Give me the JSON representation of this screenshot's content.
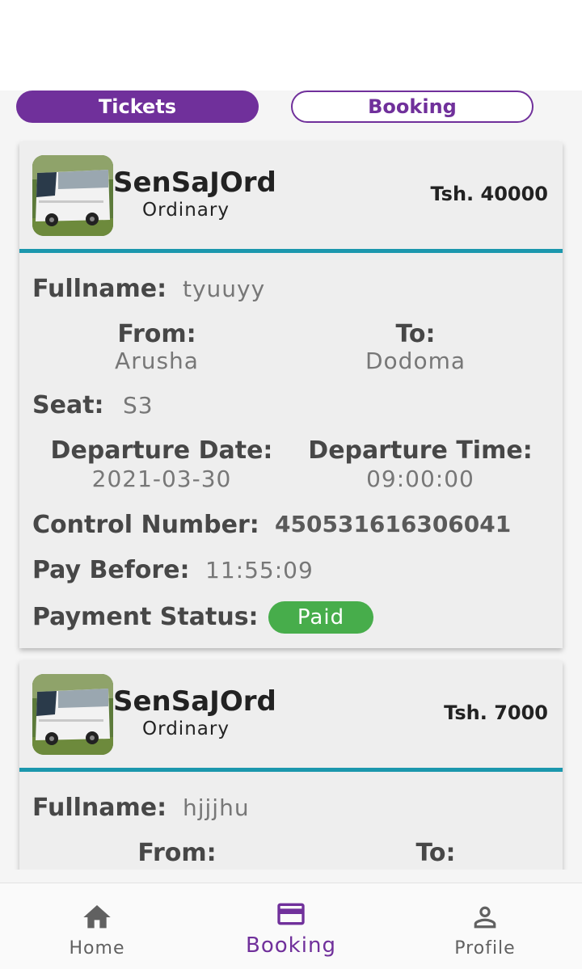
{
  "tabs": {
    "tickets": "Tickets",
    "booking": "Booking"
  },
  "tickets": [
    {
      "operator": "SenSaJOrd",
      "class": "Ordinary",
      "price": "Tsh. 40000",
      "fullname_label": "Fullname:",
      "fullname": "tyuuyy",
      "from_label": "From:",
      "from": "Arusha",
      "to_label": "To:",
      "to": "Dodoma",
      "seat_label": "Seat:",
      "seat": "S3",
      "departure_date_label": "Departure Date:",
      "departure_date": "2021-03-30",
      "departure_time_label": "Departure Time:",
      "departure_time": "09:00:00",
      "control_number_label": "Control Number:",
      "control_number": "450531616306041",
      "pay_before_label": "Pay Before:",
      "pay_before": "11:55:09",
      "payment_status_label": "Payment Status:",
      "payment_status": "Paid"
    },
    {
      "operator": "SenSaJOrd",
      "class": "Ordinary",
      "price": "Tsh. 7000",
      "fullname_label": "Fullname:",
      "fullname": "hjjjhu",
      "from_label": "From:",
      "to_label": "To:"
    }
  ],
  "nav": {
    "home": "Home",
    "booking": "Booking",
    "profile": "Profile"
  },
  "colors": {
    "accent": "#70309b",
    "divider": "#1b97ad",
    "paid": "#47ad4b"
  },
  "icons": {
    "home": "home-icon",
    "booking": "credit-card-icon",
    "profile": "person-icon"
  }
}
